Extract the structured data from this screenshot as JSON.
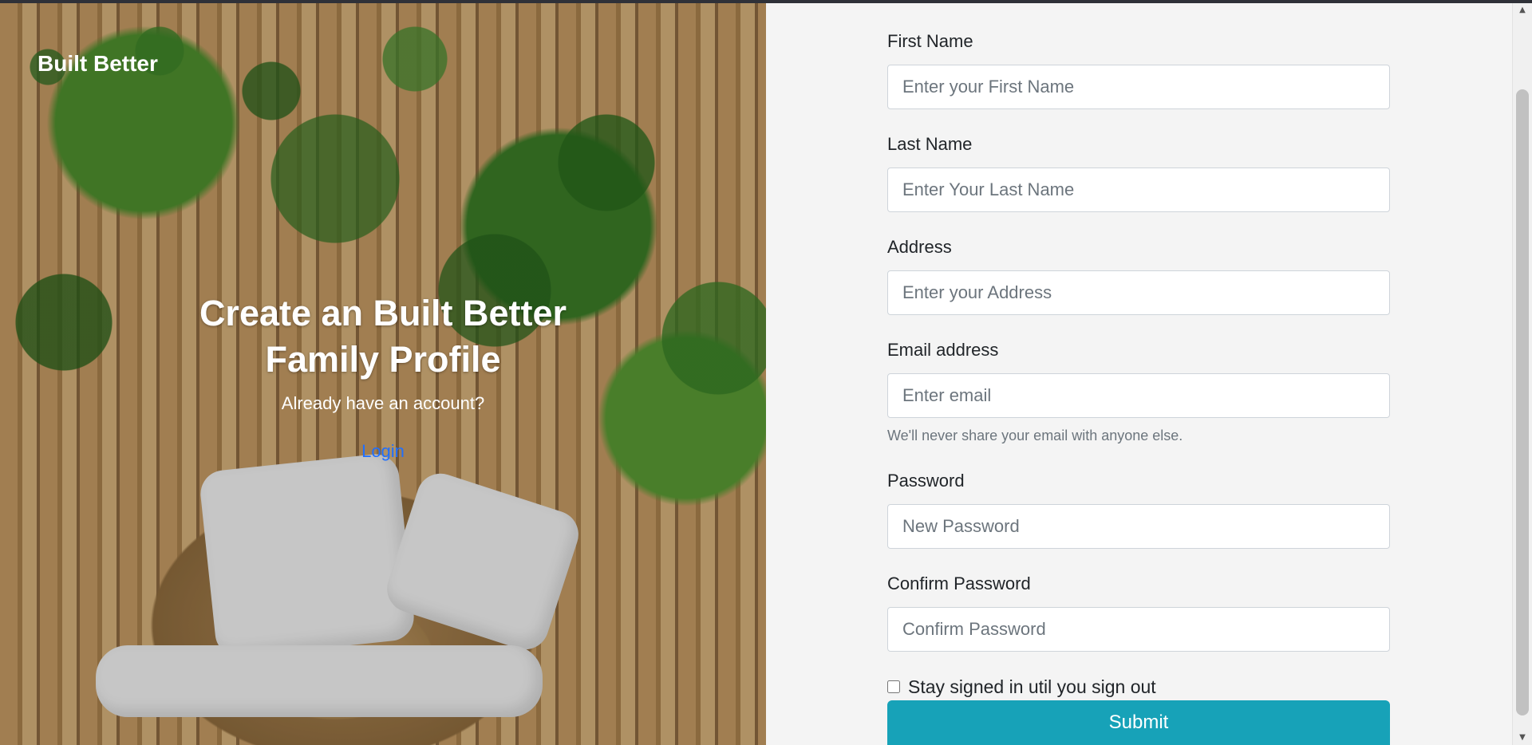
{
  "hero": {
    "brand": "Built Better",
    "title": "Create an Built Better Family Profile",
    "subtitle": "Already have an account?",
    "login_link": "Login"
  },
  "form": {
    "first_name": {
      "label": "First Name",
      "placeholder": "Enter your First Name",
      "value": ""
    },
    "last_name": {
      "label": "Last Name",
      "placeholder": "Enter Your Last Name",
      "value": ""
    },
    "address": {
      "label": "Address",
      "placeholder": "Enter your Address",
      "value": ""
    },
    "email": {
      "label": "Email address",
      "placeholder": "Enter email",
      "help": "We'll never share your email with anyone else.",
      "value": ""
    },
    "password": {
      "label": "Password",
      "placeholder": "New Password",
      "value": ""
    },
    "confirm_password": {
      "label": "Confirm Password",
      "placeholder": "Confirm Password",
      "value": ""
    },
    "stay_signed_in": {
      "label": "Stay signed in util you sign out",
      "checked": false
    },
    "submit_label": "Submit"
  },
  "colors": {
    "accent": "#17a2b8",
    "link": "#1f6fff",
    "panel": "#f4f4f4"
  },
  "icons": {
    "scroll_up": "chevron-up-icon",
    "scroll_down": "chevron-down-icon"
  }
}
